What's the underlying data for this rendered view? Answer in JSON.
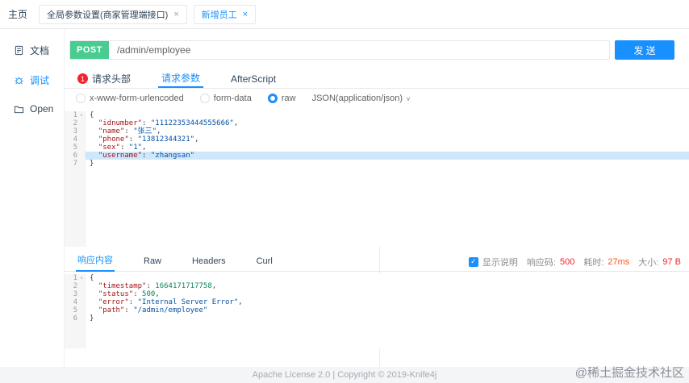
{
  "header": {
    "home_label": "主页",
    "tabs": [
      {
        "label": "全局参数设置(商家管理端接口)",
        "close": "×",
        "active": false
      },
      {
        "label": "新增员工",
        "close": "×",
        "active": true
      }
    ]
  },
  "sidebar": {
    "items": [
      {
        "label": "文档",
        "icon": "document-icon",
        "active": false
      },
      {
        "label": "调试",
        "icon": "debug-icon",
        "active": true
      },
      {
        "label": "Open",
        "icon": "folder-open-icon",
        "active": false
      }
    ]
  },
  "request": {
    "method": "POST",
    "url": "/admin/employee",
    "send_label": "发 送",
    "tabs": [
      {
        "label": "请求头部",
        "badge": "1",
        "active": false
      },
      {
        "label": "请求参数",
        "badge": "",
        "active": true
      },
      {
        "label": "AfterScript",
        "badge": "",
        "active": false
      }
    ],
    "body_modes": [
      {
        "label": "x-www-form-urlencoded",
        "selected": false
      },
      {
        "label": "form-data",
        "selected": false
      },
      {
        "label": "raw",
        "selected": true
      }
    ],
    "content_type": "JSON(application/json)",
    "caret": "∨",
    "editor": {
      "lines": [
        {
          "num": "1",
          "fold": true,
          "highlight": false,
          "tokens": [
            {
              "c": "punct",
              "v": "{"
            }
          ]
        },
        {
          "num": "2",
          "fold": false,
          "highlight": false,
          "tokens": [
            {
              "c": "punct",
              "v": "  "
            },
            {
              "c": "key",
              "v": "\"idnumber\""
            },
            {
              "c": "punct",
              "v": ": "
            },
            {
              "c": "str",
              "v": "\"11122353444555666\""
            },
            {
              "c": "punct",
              "v": ","
            }
          ]
        },
        {
          "num": "3",
          "fold": false,
          "highlight": false,
          "tokens": [
            {
              "c": "punct",
              "v": "  "
            },
            {
              "c": "key",
              "v": "\"name\""
            },
            {
              "c": "punct",
              "v": ": "
            },
            {
              "c": "str",
              "v": "\"张三\""
            },
            {
              "c": "punct",
              "v": ","
            }
          ]
        },
        {
          "num": "4",
          "fold": false,
          "highlight": false,
          "tokens": [
            {
              "c": "punct",
              "v": "  "
            },
            {
              "c": "key",
              "v": "\"phone\""
            },
            {
              "c": "punct",
              "v": ": "
            },
            {
              "c": "str",
              "v": "\"13812344321\""
            },
            {
              "c": "punct",
              "v": ","
            }
          ]
        },
        {
          "num": "5",
          "fold": false,
          "highlight": false,
          "tokens": [
            {
              "c": "punct",
              "v": "  "
            },
            {
              "c": "key",
              "v": "\"sex\""
            },
            {
              "c": "punct",
              "v": ": "
            },
            {
              "c": "str",
              "v": "\"1\""
            },
            {
              "c": "punct",
              "v": ","
            }
          ]
        },
        {
          "num": "6",
          "fold": false,
          "highlight": true,
          "tokens": [
            {
              "c": "punct",
              "v": "  "
            },
            {
              "c": "key",
              "v": "\"username\""
            },
            {
              "c": "punct",
              "v": ": "
            },
            {
              "c": "str",
              "v": "\"zhangsan\""
            }
          ]
        },
        {
          "num": "7",
          "fold": false,
          "highlight": false,
          "tokens": [
            {
              "c": "punct",
              "v": "}"
            }
          ]
        }
      ]
    }
  },
  "response": {
    "tabs": [
      {
        "label": "响应内容",
        "active": true
      },
      {
        "label": "Raw",
        "active": false
      },
      {
        "label": "Headers",
        "active": false
      },
      {
        "label": "Curl",
        "active": false
      }
    ],
    "meta": {
      "show_desc_label": "显示说明",
      "checkbox_glyph": "✓",
      "status_label": "响应码:",
      "status_value": "500",
      "time_label": "耗时:",
      "time_value": "27ms",
      "size_label": "大小:",
      "size_value": "97 B"
    },
    "editor": {
      "lines": [
        {
          "num": "1",
          "fold": true,
          "highlight": false,
          "tokens": [
            {
              "c": "punct",
              "v": "{"
            }
          ]
        },
        {
          "num": "2",
          "fold": false,
          "highlight": false,
          "tokens": [
            {
              "c": "punct",
              "v": "  "
            },
            {
              "c": "key",
              "v": "\"timestamp\""
            },
            {
              "c": "punct",
              "v": ": "
            },
            {
              "c": "num",
              "v": "1664171717758"
            },
            {
              "c": "punct",
              "v": ","
            }
          ]
        },
        {
          "num": "3",
          "fold": false,
          "highlight": false,
          "tokens": [
            {
              "c": "punct",
              "v": "  "
            },
            {
              "c": "key",
              "v": "\"status\""
            },
            {
              "c": "punct",
              "v": ": "
            },
            {
              "c": "num",
              "v": "500"
            },
            {
              "c": "punct",
              "v": ","
            }
          ]
        },
        {
          "num": "4",
          "fold": false,
          "highlight": false,
          "tokens": [
            {
              "c": "punct",
              "v": "  "
            },
            {
              "c": "key",
              "v": "\"error\""
            },
            {
              "c": "punct",
              "v": ": "
            },
            {
              "c": "str",
              "v": "\"Internal Server Error\""
            },
            {
              "c": "punct",
              "v": ","
            }
          ]
        },
        {
          "num": "5",
          "fold": false,
          "highlight": false,
          "tokens": [
            {
              "c": "punct",
              "v": "  "
            },
            {
              "c": "key",
              "v": "\"path\""
            },
            {
              "c": "punct",
              "v": ": "
            },
            {
              "c": "str",
              "v": "\"/admin/employee\""
            }
          ]
        },
        {
          "num": "6",
          "fold": false,
          "highlight": false,
          "tokens": [
            {
              "c": "punct",
              "v": "}"
            }
          ]
        }
      ]
    }
  },
  "footer": {
    "license": "Apache License 2.0 | Copyright © 2019-Knife4j",
    "watermark": "@稀土掘金技术社区"
  },
  "colors": {
    "post_green": "#49cc90",
    "accent_blue": "#1890ff",
    "badge_red": "#f5222d",
    "status_red": "#f5222d",
    "time_orange": "#fa541c",
    "json_key": "#a31515",
    "json_string": "#0451a5",
    "json_number": "#098658",
    "line_highlight": "#cfe7fb"
  }
}
